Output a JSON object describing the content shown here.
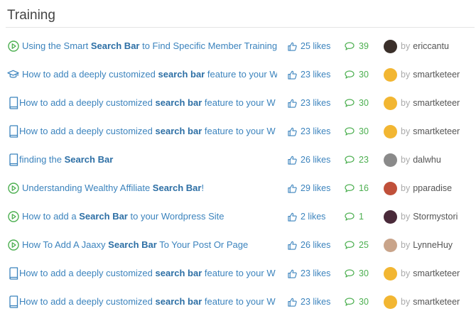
{
  "section": {
    "title": "Training"
  },
  "rows": [
    {
      "type": "video",
      "pre": "Using the Smart ",
      "bold": "Search Bar",
      "post": " to Find Specific Member Training",
      "likes": "25 likes",
      "comments": "39",
      "by": "by",
      "author": "ericcantu",
      "avatar_color": "#3a2f2a"
    },
    {
      "type": "course",
      "pre": "How to add a deeply customized ",
      "bold": "search bar",
      "post": " feature to your W",
      "likes": "23 likes",
      "comments": "30",
      "by": "by",
      "author": "smartketeer",
      "avatar_color": "#f2b632"
    },
    {
      "type": "doc",
      "pre": "How to add a deeply customized ",
      "bold": "search bar",
      "post": " feature to your W",
      "likes": "23 likes",
      "comments": "30",
      "by": "by",
      "author": "smartketeer",
      "avatar_color": "#f2b632"
    },
    {
      "type": "doc",
      "pre": "How to add a deeply customized ",
      "bold": "search bar",
      "post": " feature to your W",
      "likes": "23 likes",
      "comments": "30",
      "by": "by",
      "author": "smartketeer",
      "avatar_color": "#f2b632"
    },
    {
      "type": "doc",
      "pre": "finding the ",
      "bold": "Search Bar",
      "post": "",
      "likes": "26 likes",
      "comments": "23",
      "by": "by",
      "author": "dalwhu",
      "avatar_color": "#8a8a8a"
    },
    {
      "type": "video",
      "pre": "Understanding Wealthy Affiliate ",
      "bold": "Search Bar",
      "post": "!",
      "likes": "29 likes",
      "comments": "16",
      "by": "by",
      "author": "pparadise",
      "avatar_color": "#c0503a"
    },
    {
      "type": "video",
      "pre": "How to add a ",
      "bold": "Search Bar",
      "post": " to your Wordpress Site",
      "likes": "2 likes",
      "comments": "1",
      "by": "by",
      "author": "Stormystori",
      "avatar_color": "#4a2a3a"
    },
    {
      "type": "video",
      "pre": "How To Add A Jaaxy ",
      "bold": "Search Bar",
      "post": " To Your Post Or Page",
      "likes": "26 likes",
      "comments": "25",
      "by": "by",
      "author": "LynneHuy",
      "avatar_color": "#c9a48a"
    },
    {
      "type": "doc",
      "pre": "How to add a deeply customized ",
      "bold": "search bar",
      "post": " feature to your W",
      "likes": "23 likes",
      "comments": "30",
      "by": "by",
      "author": "smartketeer",
      "avatar_color": "#f2b632"
    },
    {
      "type": "doc",
      "pre": "How to add a deeply customized ",
      "bold": "search bar",
      "post": " feature to your W",
      "likes": "23 likes",
      "comments": "30",
      "by": "by",
      "author": "smartketeer",
      "avatar_color": "#f2b632"
    }
  ],
  "colors": {
    "link": "#3b83bd",
    "video_icon": "#4caf50",
    "comment": "#4caf50"
  }
}
